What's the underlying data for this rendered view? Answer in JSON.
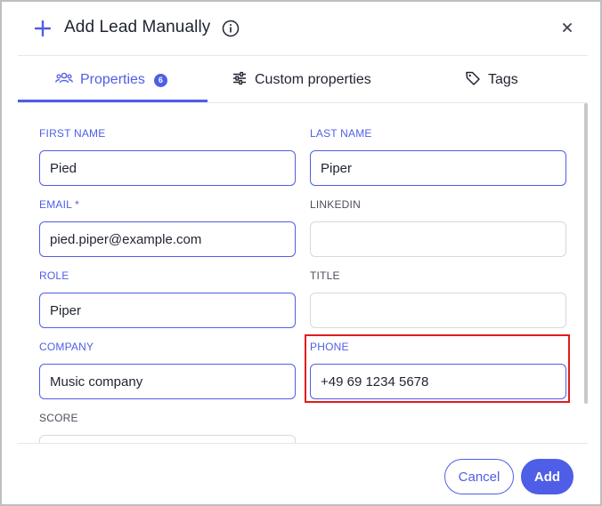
{
  "dialog": {
    "title": "Add Lead Manually"
  },
  "tabs": [
    {
      "label": "Properties",
      "badge": "6",
      "active": true
    },
    {
      "label": "Custom properties",
      "active": false
    },
    {
      "label": "Tags",
      "active": false
    }
  ],
  "fields": {
    "first_name": {
      "label": "FIRST NAME",
      "value": "Pied"
    },
    "last_name": {
      "label": "LAST NAME",
      "value": "Piper"
    },
    "email": {
      "label": "EMAIL *",
      "value": "pied.piper@example.com"
    },
    "linkedin": {
      "label": "LINKEDIN",
      "value": ""
    },
    "role": {
      "label": "ROLE",
      "value": "Piper"
    },
    "title": {
      "label": "TITLE",
      "value": ""
    },
    "company": {
      "label": "COMPANY",
      "value": "Music company"
    },
    "phone": {
      "label": "PHONE",
      "value": "+49 69 1234 5678"
    },
    "score": {
      "label": "SCORE",
      "value": ""
    }
  },
  "footer": {
    "cancel_label": "Cancel",
    "add_label": "Add"
  },
  "colors": {
    "accent": "#4f5ee6",
    "highlight": "#e01b1b",
    "text": "#1f2430",
    "border": "#d7d8de"
  }
}
